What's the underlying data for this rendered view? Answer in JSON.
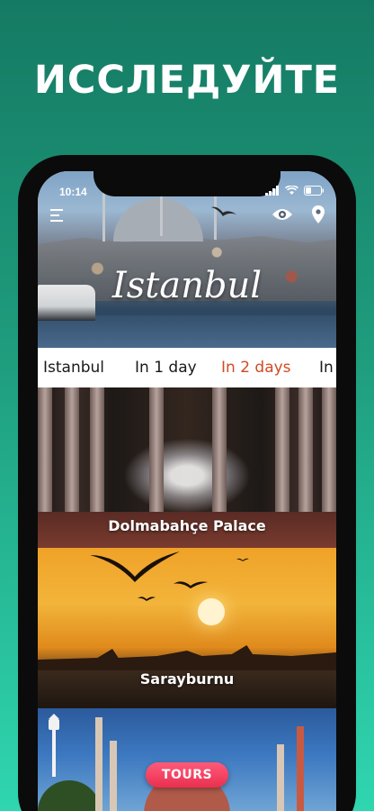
{
  "headline": "ИССЛЕДУЙТЕ",
  "status_bar": {
    "time": "10:14"
  },
  "hero": {
    "title": "Istanbul"
  },
  "header_icons": {
    "menu": "menu-icon",
    "visibility": "eye-icon",
    "location": "location-pin-icon"
  },
  "tabs": [
    {
      "label": "Istanbul",
      "active": false
    },
    {
      "label": "In 1 day",
      "active": false
    },
    {
      "label": "In 2 days",
      "active": true
    },
    {
      "label": "In",
      "active": false
    }
  ],
  "cards": [
    {
      "label": "Dolmabahçe Palace"
    },
    {
      "label": "Sarayburnu"
    },
    {
      "label": ""
    }
  ],
  "tours_button": {
    "label": "TOURS"
  },
  "colors": {
    "background_top": "#157a63",
    "background_bottom": "#2fd6b0",
    "active_tab": "#d24a23",
    "tours_button": "#e9304f"
  }
}
